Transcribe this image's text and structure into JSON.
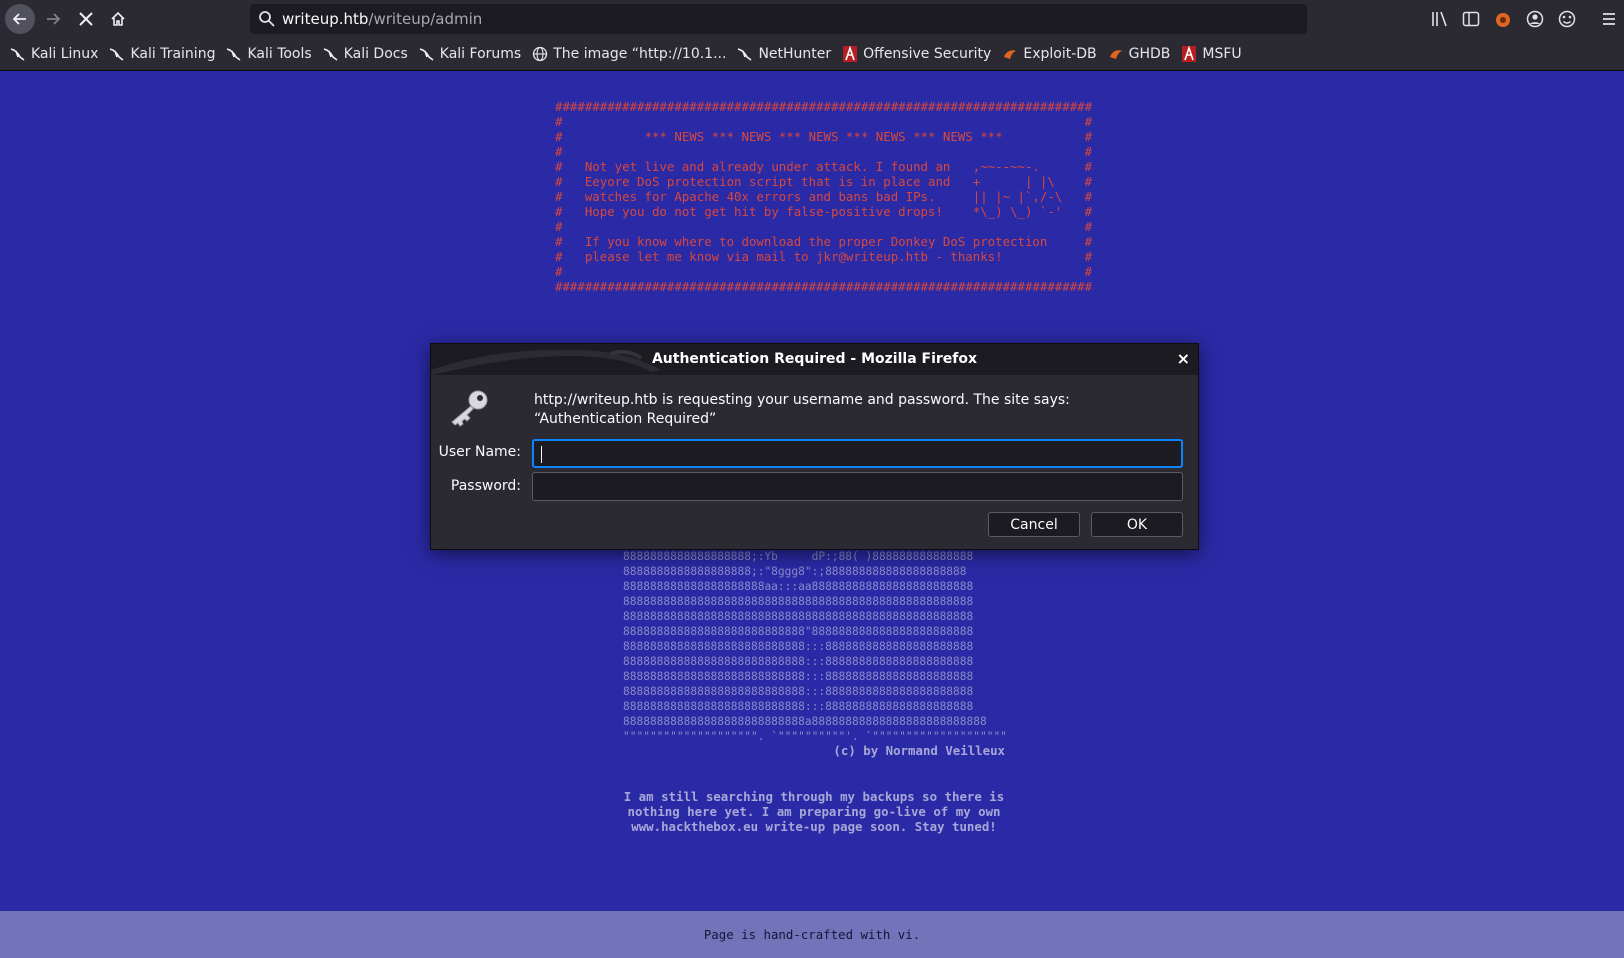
{
  "browser": {
    "url_host": "writeup.htb",
    "url_path": "/writeup/admin",
    "bookmarks": [
      {
        "label": "Kali Linux",
        "icon": "kali-dragon-icon"
      },
      {
        "label": "Kali Training",
        "icon": "kali-dragon-icon"
      },
      {
        "label": "Kali Tools",
        "icon": "kali-dragon-icon"
      },
      {
        "label": "Kali Docs",
        "icon": "kali-dragon-icon"
      },
      {
        "label": "Kali Forums",
        "icon": "kali-dragon-icon"
      },
      {
        "label": "The image “http://10.1...",
        "icon": "globe-icon"
      },
      {
        "label": "NetHunter",
        "icon": "kali-dragon-icon"
      },
      {
        "label": "Offensive Security",
        "icon": "offsec-icon"
      },
      {
        "label": "Exploit-DB",
        "icon": "exploitdb-icon"
      },
      {
        "label": "GHDB",
        "icon": "exploitdb-icon"
      },
      {
        "label": "MSFU",
        "icon": "offsec-icon"
      }
    ]
  },
  "page": {
    "banner": "########################################################################\n#                                                                      #\n#           *** NEWS *** NEWS *** NEWS *** NEWS *** NEWS ***           #\n#                                                                      #\n#   Not yet live and already under attack. I found an   ,~~--~~-.      #\n#   Eeyore DoS protection script that is in place and   +      | |\\    #\n#   watches for Apache 40x errors and bans bad IPs.     || |~ |`,/-\\   #\n#   Hope you do not get hit by false-positive drops!    *\\_) \\_) `-'   #\n#                                                                      #\n#   If you know where to download the proper Donkey DoS protection     #\n#   please let me know via mail to jkr@writeup.htb - thanks!           #\n#                                                                      #\n########################################################################",
    "ascii_art": "8888888888888888888;:Yb     dP:;88( )888888888888888\n8888888888888888888;:\"8ggg8\":;888888888888888888888\n888888888888888888888aa:::aa888888888888888888888888\n8888888888888888888888888888888888888888888888888888\n8888888888888888888888888888888888888888888888888888\n888888888888888888888888888\"888888888888888888888888\n888888888888888888888888888:::8888888888888888888888\n888888888888888888888888888:::8888888888888888888888\n888888888888888888888888888:::8888888888888888888888\n888888888888888888888888888:::8888888888888888888888\n888888888888888888888888888:::8888888888888888888888\n888888888888888888888888888a88888888888888888888888888\n\"\"\"\"\"\"\"\"\"\"\"\"\"\"\"\"\"\"\"\". `\"\"\"\"\"\"\"\"\"\"'. `\"\"\"\"\"\"\"\"\"\"\"\"\"\"\"\"\"\"\"\"",
    "credit": "(c) by Normand Veilleux",
    "note": "I am still searching through my backups so there is\nnothing here yet. I am preparing go-live of my own\nwww.hackthebox.eu write-up page soon. Stay tuned!",
    "footer": "Page is hand-crafted with vi."
  },
  "dialog": {
    "title": "Authentication Required - Mozilla Firefox",
    "message": "http://writeup.htb is requesting your username and password. The site says: “Authentication Required”",
    "username_label": "User Name:",
    "username_value": "",
    "password_label": "Password:",
    "password_value": "",
    "cancel_label": "Cancel",
    "ok_label": "OK",
    "close_glyph": "×"
  }
}
